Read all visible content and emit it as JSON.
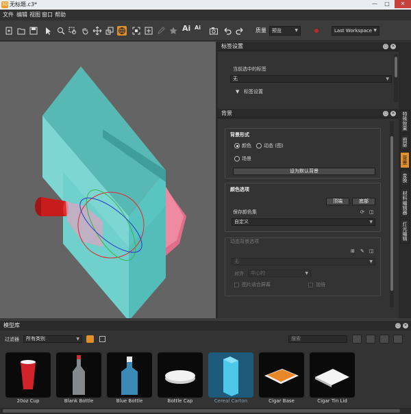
{
  "window": {
    "title": "无标题.c3*",
    "app_icon": "3D"
  },
  "menu": [
    "文件",
    "编辑",
    "视图",
    "窗口",
    "帮助"
  ],
  "toolbar": {
    "quality_label": "质量",
    "quality_value": "预览",
    "workspace_value": "Last Workspace",
    "ai_label": "Ai",
    "ai_sub_label": "Ai"
  },
  "tag_panel": {
    "title": "标签设置",
    "current_tag_label": "当前选中的标签",
    "current_tag_value": "无",
    "tag_settings_label": "标签设置"
  },
  "bg_panel": {
    "title": "背景",
    "bg_form_label": "背景形式",
    "radio_color": "颜色",
    "radio_dynamic": "动态 (图)",
    "radio_scene": "场景",
    "set_default_button": "设为默认背景",
    "color_options_label": "颜色选项",
    "top_button": "顶端",
    "bottom_button": "底部",
    "save_color_set_label": "保存颜色集",
    "color_set_value": "自定义",
    "dynamic_options_label": "动态背景选项",
    "dynamic_value": "无",
    "align_label": "对齐",
    "align_value": "中心的",
    "fit_screen_label": "图片适合屏幕",
    "tile_label": "加倍"
  },
  "side_tabs": [
    "特殊效果",
    "图层",
    "背景",
    "变换",
    "材料编辑器",
    "灯光编辑"
  ],
  "side_tab_active": "背景",
  "library": {
    "title": "模型库",
    "filter_label": "过滤器",
    "filter_value": "所有类别",
    "search_placeholder": "搜索",
    "items": [
      {
        "label": "20oz Cup",
        "icon": "red-cup-icon"
      },
      {
        "label": "Blank Bottle",
        "icon": "glass-bottle-icon"
      },
      {
        "label": "Blue Bottle",
        "icon": "blue-bottle-icon"
      },
      {
        "label": "Bottle Cap",
        "icon": "bottle-cap-icon"
      },
      {
        "label": "Cereal Carton",
        "icon": "carton-icon"
      },
      {
        "label": "Cigar Base",
        "icon": "cigar-box-icon"
      },
      {
        "label": "Cigar Tin Lid",
        "icon": "tin-lid-icon"
      }
    ],
    "selected_item": "Cereal Carton"
  },
  "colors": {
    "accent_orange": "#e0902a",
    "carton_cyan": "#6fd0cc",
    "cup_red": "#c81c1c",
    "viewport_gray": "#646464"
  }
}
